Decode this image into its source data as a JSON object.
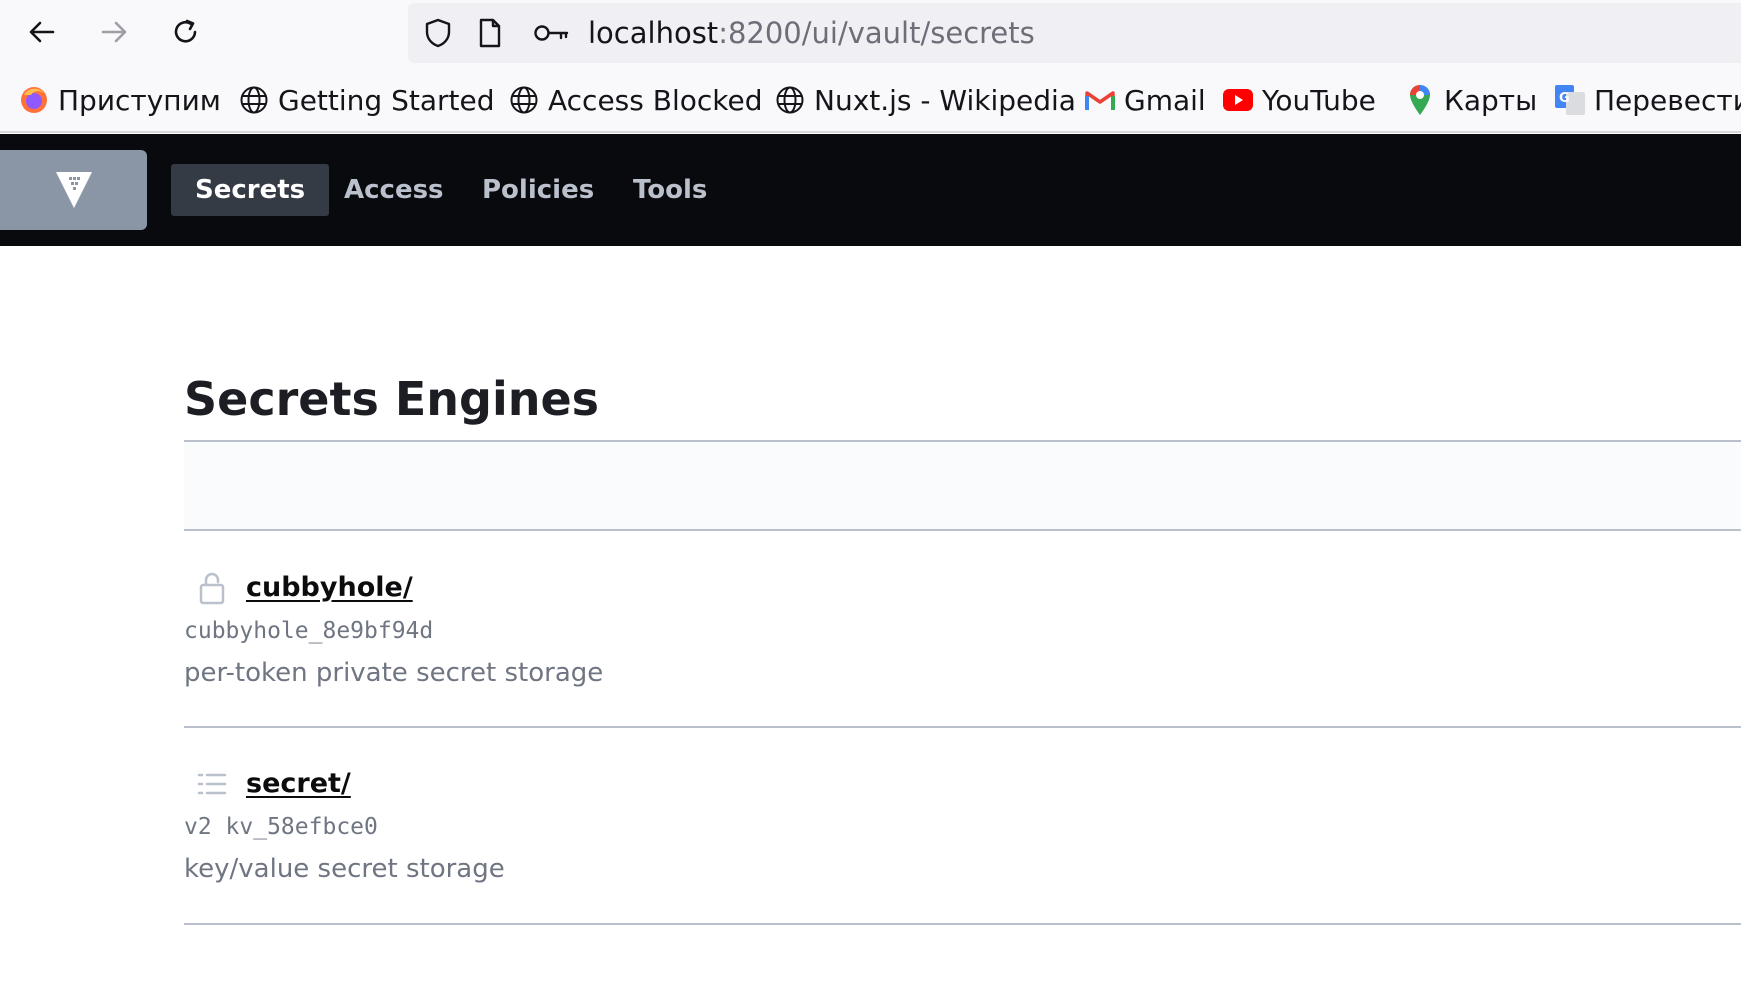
{
  "browser": {
    "url_host": "localhost",
    "url_path": ":8200/ui/vault/secrets",
    "bookmarks": [
      {
        "label": "Приступим",
        "icon": "firefox-icon"
      },
      {
        "label": "Getting Started",
        "icon": "globe-icon"
      },
      {
        "label": "Access Blocked",
        "icon": "globe-icon"
      },
      {
        "label": "Nuxt.js - Wikipedia",
        "icon": "globe-icon"
      },
      {
        "label": "Gmail",
        "icon": "gmail-icon"
      },
      {
        "label": "YouTube",
        "icon": "youtube-icon"
      },
      {
        "label": "Карты",
        "icon": "maps-pin-icon"
      },
      {
        "label": "Перевести",
        "icon": "translate-icon"
      }
    ]
  },
  "header": {
    "tabs": [
      {
        "label": "Secrets",
        "active": true
      },
      {
        "label": "Access",
        "active": false
      },
      {
        "label": "Policies",
        "active": false
      },
      {
        "label": "Tools",
        "active": false
      }
    ]
  },
  "main": {
    "title": "Secrets Engines",
    "engines": [
      {
        "path": "cubbyhole/",
        "accessor": "cubbyhole_8e9bf94d",
        "description": "per-token private secret storage",
        "icon": "lock-icon"
      },
      {
        "path": "secret/",
        "accessor": "v2 kv_58efbce0",
        "description": "key/value secret storage",
        "icon": "list-icon"
      }
    ]
  },
  "colors": {
    "header_bg": "#090a0d",
    "active_tab_bg": "#353b45",
    "logo_bg": "#8a96a6",
    "muted_text": "#6f7682"
  }
}
